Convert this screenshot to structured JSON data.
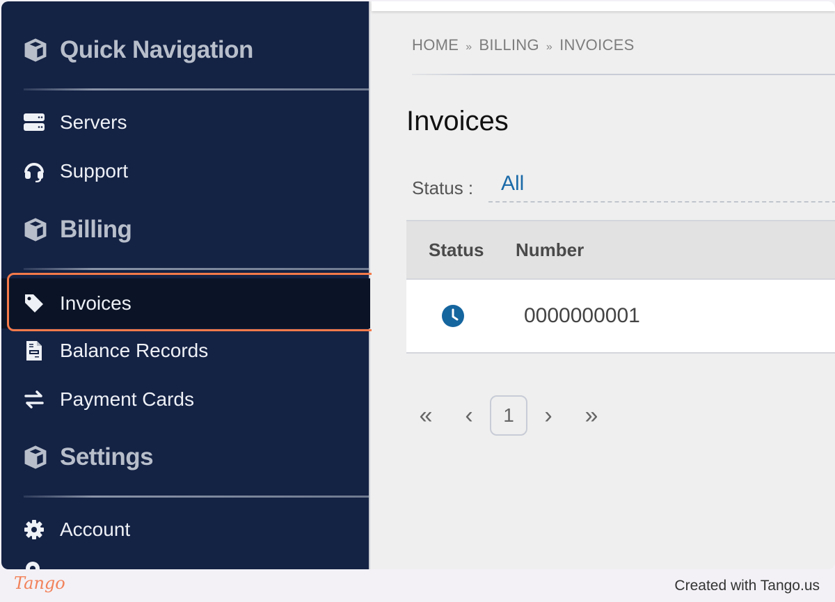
{
  "sidebar": {
    "groups": [
      {
        "title": "Quick Navigation",
        "icon": "cube-icon"
      },
      {
        "title": "Billing",
        "icon": "cube-icon"
      },
      {
        "title": "Settings",
        "icon": "cube-icon"
      }
    ],
    "items": [
      {
        "label": "Servers",
        "icon": "server-icon"
      },
      {
        "label": "Support",
        "icon": "headset-icon"
      },
      {
        "label": "Invoices",
        "icon": "tag-icon",
        "active": true
      },
      {
        "label": "Balance Records",
        "icon": "document-icon"
      },
      {
        "label": "Payment Cards",
        "icon": "exchange-icon"
      },
      {
        "label": "Account",
        "icon": "gear-icon"
      }
    ]
  },
  "breadcrumb": {
    "items": [
      "HOME",
      "BILLING",
      "INVOICES"
    ],
    "separator": "»"
  },
  "main": {
    "title": "Invoices",
    "status_filter": {
      "label": "Status :",
      "value": "All"
    },
    "table": {
      "columns": [
        "Status",
        "Number"
      ],
      "rows": [
        {
          "status_icon": "clock-icon",
          "number": "0000000001"
        }
      ]
    },
    "pagination": {
      "first": "«",
      "prev": "‹",
      "current": "1",
      "next": "›",
      "last": "»"
    }
  },
  "colors": {
    "sidebar_bg": "#142244",
    "accent": "#1a6aa8",
    "highlight": "#f47a4a"
  },
  "footer": {
    "logo": "Tango",
    "created": "Created with Tango.us"
  }
}
